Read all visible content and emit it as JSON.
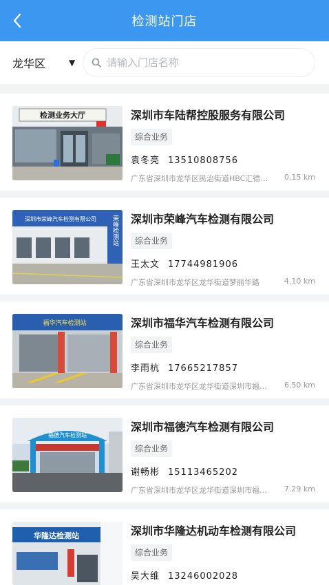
{
  "header": {
    "title": "检测站门店",
    "back_icon": "chevron-left-icon"
  },
  "filter": {
    "district": "龙华区",
    "caret_icon": "caret-down-icon",
    "search_icon": "search-icon",
    "search_placeholder": "请输入门店名称",
    "search_value": ""
  },
  "stores": [
    {
      "name": "深圳市车陆帮控股服务有限公司",
      "tag": "综合业务",
      "contact": "袁冬亮",
      "phone": "13510808756",
      "address": "广东省深圳市龙华区民治街道HBC汇德大厦",
      "distance": "0.15 km",
      "photo_sign": "检测业务大厅"
    },
    {
      "name": "深圳市荣峰汽车检测有限公司",
      "tag": "综合业务",
      "contact": "王太文",
      "phone": "17744981906",
      "address": "广东省深圳市龙华区龙华街道梦丽华路",
      "distance": "4.10 km",
      "photo_sign": "深圳市荣峰汽车检测有限公司",
      "photo_side_sign": "荣峰检测站"
    },
    {
      "name": "深圳市福华汽车检测有限公司",
      "tag": "综合业务",
      "contact": "李雨杭",
      "phone": "17665217857",
      "address": "广东省深圳市龙华区龙华街道深圳市福华路",
      "distance": "6.50 km",
      "photo_sign": "福华汽车检测站"
    },
    {
      "name": "深圳市福德汽车检测有限公司",
      "tag": "综合业务",
      "contact": "谢畅彬",
      "phone": "15113465202",
      "address": "广东省深圳市龙华区龙华街道深圳市福德路",
      "distance": "7.29 km",
      "photo_sign": "福德汽车检测站"
    },
    {
      "name": "深圳市华隆达机动车检测有限公司",
      "tag": "综合业务",
      "contact": "吴大维",
      "phone": "13246002028",
      "address": "",
      "distance": "",
      "photo_sign": "华隆达检测站"
    }
  ]
}
